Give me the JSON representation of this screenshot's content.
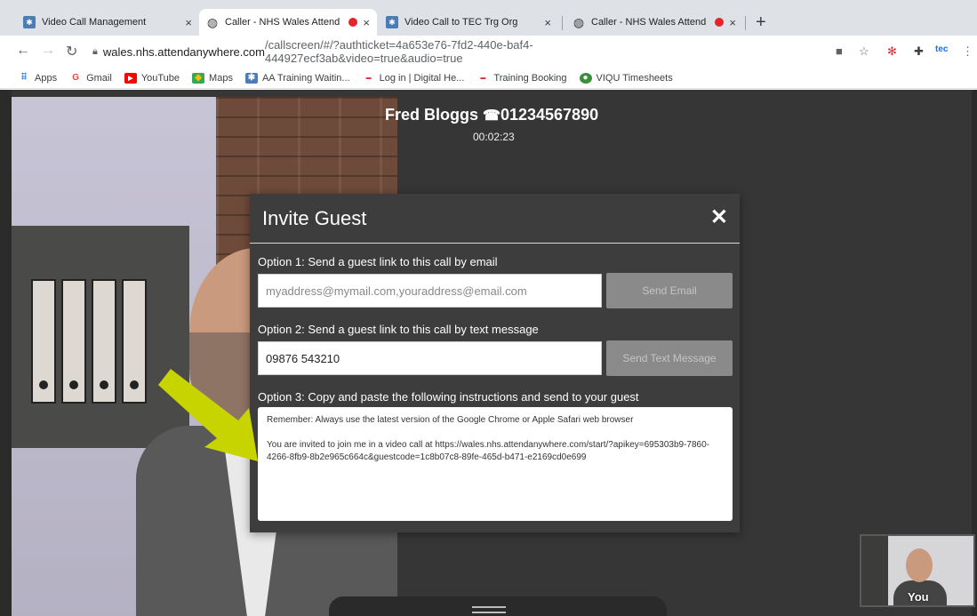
{
  "browser": {
    "tabs": [
      {
        "title": "Video Call Management",
        "close": "×"
      },
      {
        "title": "Caller - NHS Wales Attend",
        "close": "×"
      },
      {
        "title": "Video Call to TEC Trg Org",
        "close": "×"
      },
      {
        "title": "Caller - NHS Wales Attend",
        "close": "×"
      }
    ],
    "new_tab": "+",
    "url_host": "wales.nhs.attendanywhere.com",
    "url_path": "/callscreen/#/?authticket=4a653e76-7fd2-440e-baf4-444927ecf3ab&video=true&audio=true",
    "bookmarks": [
      {
        "label": "Apps",
        "icon": "apps-grid-icon"
      },
      {
        "label": "Gmail",
        "icon": "google-icon"
      },
      {
        "label": "YouTube",
        "icon": "youtube-icon"
      },
      {
        "label": "Maps",
        "icon": "maps-icon"
      },
      {
        "label": "AA Training Waitin...",
        "icon": "attend-anywhere-icon"
      },
      {
        "label": "Log in | Digital He...",
        "icon": "dhw-icon"
      },
      {
        "label": "Training Booking",
        "icon": "dhw-icon"
      },
      {
        "label": "VIQU Timesheets",
        "icon": "viqu-icon"
      }
    ],
    "tec_badge": "tec"
  },
  "call": {
    "caller_name": "Fred Bloggs",
    "caller_phone": "01234567890",
    "timer": "00:02:23",
    "self_label": "You"
  },
  "dialog": {
    "title": "Invite Guest",
    "close": "✕",
    "option1_label": "Option 1: Send a guest link to this call by email",
    "email_placeholder": "myaddress@mymail.com,youraddress@email.com",
    "send_email": "Send Email",
    "option2_label": "Option 2: Send a guest link to this call by text message",
    "phone_value": "09876 543210",
    "send_text": "Send Text Message",
    "option3_label": "Option 3: Copy and paste the following instructions and send to your guest",
    "instructions_line1": "Remember: Always use the latest version of the Google Chrome or Apple Safari web browser",
    "instructions_line2": "You are invited to join me in a video call at https://wales.nhs.attendanywhere.com/start/?apikey=695303b9-7860-4266-8fb9-8b2e965c664c&guestcode=1c8b07c8-89fe-465d-b471-e2169cd0e699"
  },
  "colors": {
    "arrow": "#c8d400",
    "rec_dot": "#e4252b",
    "screen_bg": "#363636",
    "dialog_bg": "#3d3d3d"
  }
}
